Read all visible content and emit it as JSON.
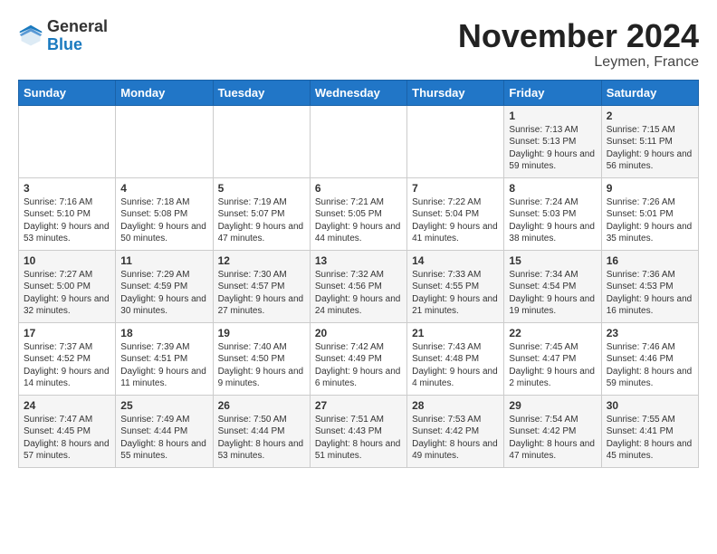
{
  "header": {
    "logo_general": "General",
    "logo_blue": "Blue",
    "month_title": "November 2024",
    "location": "Leymen, France"
  },
  "days_of_week": [
    "Sunday",
    "Monday",
    "Tuesday",
    "Wednesday",
    "Thursday",
    "Friday",
    "Saturday"
  ],
  "weeks": [
    {
      "days": [
        {
          "num": "",
          "info": ""
        },
        {
          "num": "",
          "info": ""
        },
        {
          "num": "",
          "info": ""
        },
        {
          "num": "",
          "info": ""
        },
        {
          "num": "",
          "info": ""
        },
        {
          "num": "1",
          "info": "Sunrise: 7:13 AM\nSunset: 5:13 PM\nDaylight: 9 hours\nand 59 minutes."
        },
        {
          "num": "2",
          "info": "Sunrise: 7:15 AM\nSunset: 5:11 PM\nDaylight: 9 hours\nand 56 minutes."
        }
      ]
    },
    {
      "days": [
        {
          "num": "3",
          "info": "Sunrise: 7:16 AM\nSunset: 5:10 PM\nDaylight: 9 hours\nand 53 minutes."
        },
        {
          "num": "4",
          "info": "Sunrise: 7:18 AM\nSunset: 5:08 PM\nDaylight: 9 hours\nand 50 minutes."
        },
        {
          "num": "5",
          "info": "Sunrise: 7:19 AM\nSunset: 5:07 PM\nDaylight: 9 hours\nand 47 minutes."
        },
        {
          "num": "6",
          "info": "Sunrise: 7:21 AM\nSunset: 5:05 PM\nDaylight: 9 hours\nand 44 minutes."
        },
        {
          "num": "7",
          "info": "Sunrise: 7:22 AM\nSunset: 5:04 PM\nDaylight: 9 hours\nand 41 minutes."
        },
        {
          "num": "8",
          "info": "Sunrise: 7:24 AM\nSunset: 5:03 PM\nDaylight: 9 hours\nand 38 minutes."
        },
        {
          "num": "9",
          "info": "Sunrise: 7:26 AM\nSunset: 5:01 PM\nDaylight: 9 hours\nand 35 minutes."
        }
      ]
    },
    {
      "days": [
        {
          "num": "10",
          "info": "Sunrise: 7:27 AM\nSunset: 5:00 PM\nDaylight: 9 hours\nand 32 minutes."
        },
        {
          "num": "11",
          "info": "Sunrise: 7:29 AM\nSunset: 4:59 PM\nDaylight: 9 hours\nand 30 minutes."
        },
        {
          "num": "12",
          "info": "Sunrise: 7:30 AM\nSunset: 4:57 PM\nDaylight: 9 hours\nand 27 minutes."
        },
        {
          "num": "13",
          "info": "Sunrise: 7:32 AM\nSunset: 4:56 PM\nDaylight: 9 hours\nand 24 minutes."
        },
        {
          "num": "14",
          "info": "Sunrise: 7:33 AM\nSunset: 4:55 PM\nDaylight: 9 hours\nand 21 minutes."
        },
        {
          "num": "15",
          "info": "Sunrise: 7:34 AM\nSunset: 4:54 PM\nDaylight: 9 hours\nand 19 minutes."
        },
        {
          "num": "16",
          "info": "Sunrise: 7:36 AM\nSunset: 4:53 PM\nDaylight: 9 hours\nand 16 minutes."
        }
      ]
    },
    {
      "days": [
        {
          "num": "17",
          "info": "Sunrise: 7:37 AM\nSunset: 4:52 PM\nDaylight: 9 hours\nand 14 minutes."
        },
        {
          "num": "18",
          "info": "Sunrise: 7:39 AM\nSunset: 4:51 PM\nDaylight: 9 hours\nand 11 minutes."
        },
        {
          "num": "19",
          "info": "Sunrise: 7:40 AM\nSunset: 4:50 PM\nDaylight: 9 hours\nand 9 minutes."
        },
        {
          "num": "20",
          "info": "Sunrise: 7:42 AM\nSunset: 4:49 PM\nDaylight: 9 hours\nand 6 minutes."
        },
        {
          "num": "21",
          "info": "Sunrise: 7:43 AM\nSunset: 4:48 PM\nDaylight: 9 hours\nand 4 minutes."
        },
        {
          "num": "22",
          "info": "Sunrise: 7:45 AM\nSunset: 4:47 PM\nDaylight: 9 hours\nand 2 minutes."
        },
        {
          "num": "23",
          "info": "Sunrise: 7:46 AM\nSunset: 4:46 PM\nDaylight: 8 hours\nand 59 minutes."
        }
      ]
    },
    {
      "days": [
        {
          "num": "24",
          "info": "Sunrise: 7:47 AM\nSunset: 4:45 PM\nDaylight: 8 hours\nand 57 minutes."
        },
        {
          "num": "25",
          "info": "Sunrise: 7:49 AM\nSunset: 4:44 PM\nDaylight: 8 hours\nand 55 minutes."
        },
        {
          "num": "26",
          "info": "Sunrise: 7:50 AM\nSunset: 4:44 PM\nDaylight: 8 hours\nand 53 minutes."
        },
        {
          "num": "27",
          "info": "Sunrise: 7:51 AM\nSunset: 4:43 PM\nDaylight: 8 hours\nand 51 minutes."
        },
        {
          "num": "28",
          "info": "Sunrise: 7:53 AM\nSunset: 4:42 PM\nDaylight: 8 hours\nand 49 minutes."
        },
        {
          "num": "29",
          "info": "Sunrise: 7:54 AM\nSunset: 4:42 PM\nDaylight: 8 hours\nand 47 minutes."
        },
        {
          "num": "30",
          "info": "Sunrise: 7:55 AM\nSunset: 4:41 PM\nDaylight: 8 hours\nand 45 minutes."
        }
      ]
    }
  ]
}
